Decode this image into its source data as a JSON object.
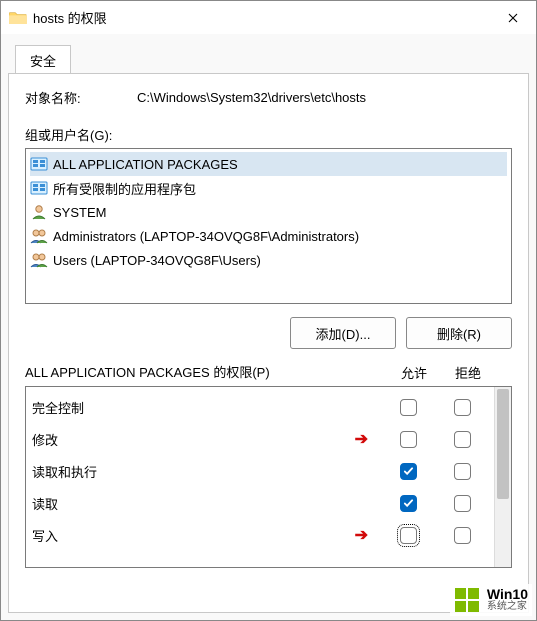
{
  "title": "hosts 的权限",
  "tab": "安全",
  "object_label": "对象名称:",
  "object_value": "C:\\Windows\\System32\\drivers\\etc\\hosts",
  "group_label": "组或用户名(G):",
  "groups": [
    {
      "name": "ALL APPLICATION PACKAGES",
      "icon": "pkg"
    },
    {
      "name": "所有受限制的应用程序包",
      "icon": "pkg"
    },
    {
      "name": "SYSTEM",
      "icon": "user"
    },
    {
      "name": "Administrators (LAPTOP-34OVQG8F\\Administrators)",
      "icon": "group"
    },
    {
      "name": "Users (LAPTOP-34OVQG8F\\Users)",
      "icon": "group"
    }
  ],
  "buttons": {
    "add": "添加(D)...",
    "remove": "删除(R)"
  },
  "perm_for": "ALL APPLICATION PACKAGES 的权限(P)",
  "cols": {
    "allow": "允许",
    "deny": "拒绝"
  },
  "perms": [
    {
      "name": "完全控制",
      "allow": false,
      "deny": false,
      "arrow": false,
      "focus": false
    },
    {
      "name": "修改",
      "allow": false,
      "deny": false,
      "arrow": true,
      "focus": false
    },
    {
      "name": "读取和执行",
      "allow": true,
      "deny": false,
      "arrow": false,
      "focus": false
    },
    {
      "name": "读取",
      "allow": true,
      "deny": false,
      "arrow": false,
      "focus": false
    },
    {
      "name": "写入",
      "allow": false,
      "deny": false,
      "arrow": true,
      "focus": true
    }
  ],
  "watermark": {
    "l1": "Win10",
    "l2": "系统之家"
  }
}
